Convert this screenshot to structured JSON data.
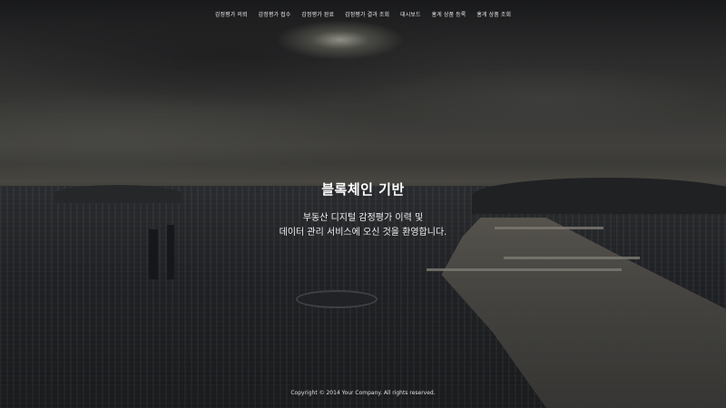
{
  "nav": {
    "items": [
      {
        "label": "감정평가 의뢰"
      },
      {
        "label": "감정평가 접수"
      },
      {
        "label": "감정평가 완료"
      },
      {
        "label": "감정평가 결과 조회"
      },
      {
        "label": "대시보드"
      },
      {
        "label": "홍게 상품 등록"
      },
      {
        "label": "홍게 상품 조회"
      }
    ]
  },
  "hero": {
    "title": "블록체인 기반",
    "subtitle_line1": "부동산 디지털 감정평가 이력 및",
    "subtitle_line2": "데이터 관리 서비스에 오신 것을 환영합니다."
  },
  "footer": {
    "copyright": "Copyright © 2014 Your Company. All rights reserved."
  },
  "colors": {
    "text": "#ffffff",
    "overlay": "#000000"
  }
}
